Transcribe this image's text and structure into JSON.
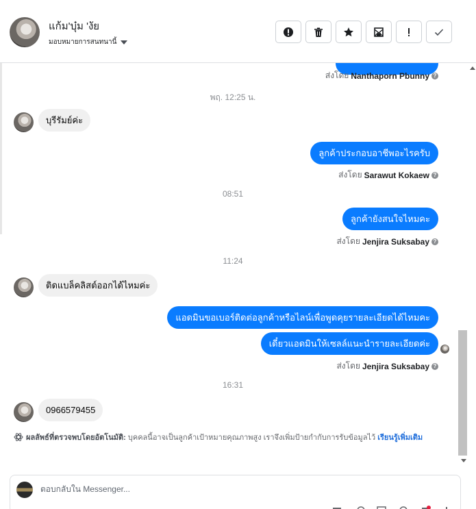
{
  "header": {
    "contact_name": "แก้ม'บุ๋ม 'งัย",
    "assign_label": "มอบหมายการสนทนานี้",
    "actions": [
      {
        "name": "report-spam-button",
        "icon": "alert-circle-icon"
      },
      {
        "name": "delete-button",
        "icon": "trash-icon"
      },
      {
        "name": "star-button",
        "icon": "star-icon"
      },
      {
        "name": "mark-unread-button",
        "icon": "envelope-icon"
      },
      {
        "name": "follow-up-button",
        "icon": "exclamation-icon",
        "text": "!"
      },
      {
        "name": "mark-done-button",
        "icon": "check-icon"
      }
    ]
  },
  "thread": {
    "messages": [
      {
        "type": "sent_by",
        "text": "ส่งโดย",
        "agent": "Nanthaporn Pbunny"
      },
      {
        "type": "timestamp",
        "text": "พฤ. 12:25 น."
      },
      {
        "type": "in",
        "text": "บุรีรัมย์ค่ะ"
      },
      {
        "type": "out",
        "text": "ลูกค้าประกอบอาชีพอะไรครับ"
      },
      {
        "type": "sent_by",
        "text": "ส่งโดย",
        "agent": "Sarawut Kokaew"
      },
      {
        "type": "timestamp",
        "text": "08:51"
      },
      {
        "type": "out",
        "text": "ลูกค้ายังสนใจไหมคะ"
      },
      {
        "type": "sent_by",
        "text": "ส่งโดย",
        "agent": "Jenjira Suksabay"
      },
      {
        "type": "timestamp",
        "text": "11:24"
      },
      {
        "type": "in",
        "text": "ติดแบล็คลิสต์ออกได้ไหมค่ะ"
      },
      {
        "type": "out",
        "text": "แอดมินขอเบอร์ติดต่อลูกค้าหรือไลน์เพื่อพูดคุยรายละเอียดได้ไหมคะ"
      },
      {
        "type": "out",
        "text": "เดี๋ยวแอดมินให้เซลล์แนะนำรายละเอียดค่ะ"
      },
      {
        "type": "sent_by",
        "text": "ส่งโดย",
        "agent": "Jenjira Suksabay"
      },
      {
        "type": "timestamp",
        "text": "16:31"
      },
      {
        "type": "in",
        "text": "0966579455"
      }
    ],
    "ai_note": {
      "label": "ผลลัพธ์ที่ตรวจพบโดยอัตโนมัติ:",
      "text": "บุคคลนี้อาจเป็นลูกค้าเป้าหมายคุณภาพสูง เราจึงเพิ่มป้ายกำกับการรับข้อมูลไว้",
      "link": "เรียนรู้เพิ่มเติม"
    }
  },
  "reply": {
    "placeholder": "ตอบกลับใน Messenger..."
  },
  "colors": {
    "outgoing_bubble": "#0a7cff",
    "incoming_bubble": "#f0f0f0",
    "link": "#216fdb"
  }
}
